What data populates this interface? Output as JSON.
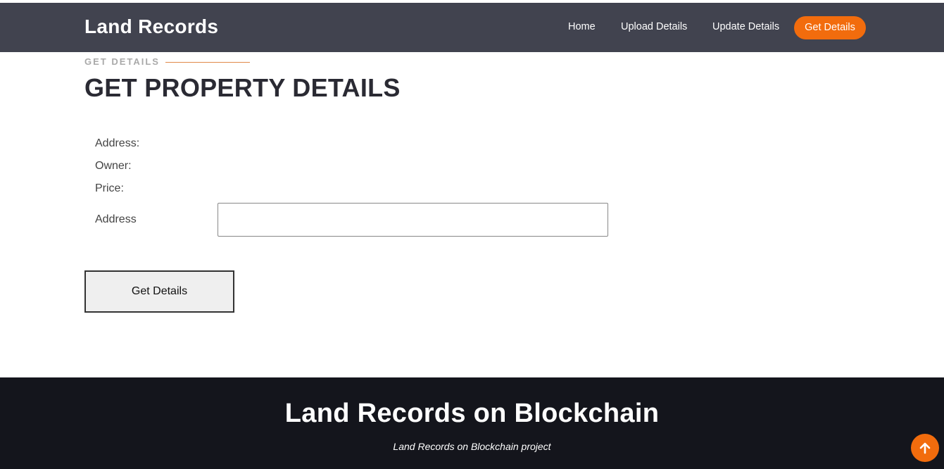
{
  "navbar": {
    "brand": "Land Records",
    "items": [
      {
        "label": "Home"
      },
      {
        "label": "Upload Details"
      },
      {
        "label": "Update Details"
      },
      {
        "label": "Get Details"
      }
    ],
    "active_item": "Get Details",
    "active_color": "#f26c0d",
    "background": "#41434f"
  },
  "section": {
    "label": "GET DETAILS",
    "title": "GET PROPERTY DETAILS"
  },
  "details": {
    "address_label": "Address:",
    "owner_label": "Owner:",
    "price_label": "Price:"
  },
  "form": {
    "address_label": "Address",
    "address_value": "",
    "button_label": "Get Details"
  },
  "footer": {
    "title": "Land Records on Blockchain",
    "subtitle": "Land Records on Blockchain project",
    "background": "#14151c"
  },
  "scroll_top": {
    "icon": "arrow-up-icon",
    "color": "#f26c0d"
  }
}
